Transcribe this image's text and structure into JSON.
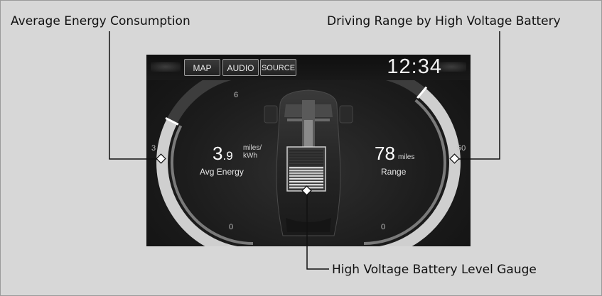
{
  "callouts": {
    "average_energy": "Average Energy Consumption",
    "driving_range": "Driving Range by High Voltage Battery",
    "battery_gauge": "High Voltage Battery Level Gauge"
  },
  "topbar": {
    "map_label": "MAP",
    "audio_label": "AUDIO",
    "source_label": "SOURCE",
    "clock": "12:34"
  },
  "energy_gauge": {
    "tick_max": "6",
    "tick_mid": "3",
    "tick_min": "0",
    "value_int": "3",
    "value_dec": ".9",
    "unit_line1": "miles/",
    "unit_line2": "kWh",
    "label": "Avg Energy",
    "level": 0.65
  },
  "range_gauge": {
    "tick_mid": "50",
    "tick_min": "0",
    "value": "78",
    "unit": "miles",
    "label": "Range",
    "level": 0.78
  },
  "battery": {
    "level": 0.6
  },
  "colors": {
    "background": "#d7d7d7",
    "screen": "#1c1c1c",
    "gauge_fill": "#cfcfcf",
    "gauge_track": "#3d3d3d"
  }
}
